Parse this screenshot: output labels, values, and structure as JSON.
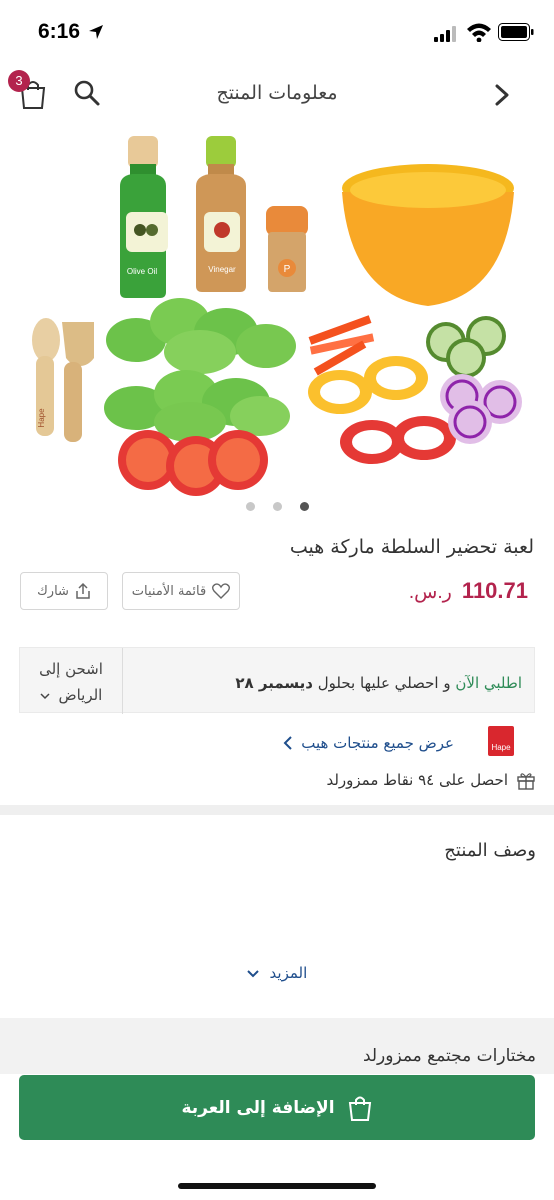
{
  "status_bar": {
    "time": "6:16"
  },
  "header": {
    "title": "معلومات المنتج",
    "cart_count": "3"
  },
  "carousel": {
    "dot_count": 3,
    "active_index": 2
  },
  "image_labels": {
    "bottle1": "Olive Oil",
    "bottle2": "Vinegar",
    "shaker": "P",
    "spoon": "Hape"
  },
  "product": {
    "title": "لعبة تحضير السلطة ماركة هيب",
    "price": "110.71",
    "currency": "ر.س.",
    "wishlist_label": "قائمة الأمنيات",
    "share_label": "شارك"
  },
  "delivery": {
    "order_now": "اطلبي الآن",
    "middle": " و احصلي عليها بحلول ",
    "date": "ديسمبر ٢٨",
    "ship_to_line1": "اشحن إلى",
    "ship_to_line2": "الرياض"
  },
  "brand": {
    "logo_text": "Hape",
    "link": "عرض جميع منتجات هيب"
  },
  "points": {
    "text": "احصل على ٩٤ نقاط ممزورلد"
  },
  "description": {
    "title": "وصف المنتج",
    "more": "المزيد"
  },
  "community": {
    "title": "مختارات مجتمع ممزورلد"
  },
  "cta": {
    "add_to_cart": "الإضافة إلى العربة"
  },
  "colors": {
    "accent": "#b3234d",
    "cta_green": "#2e8b57",
    "link_blue": "#1f4e8c"
  }
}
